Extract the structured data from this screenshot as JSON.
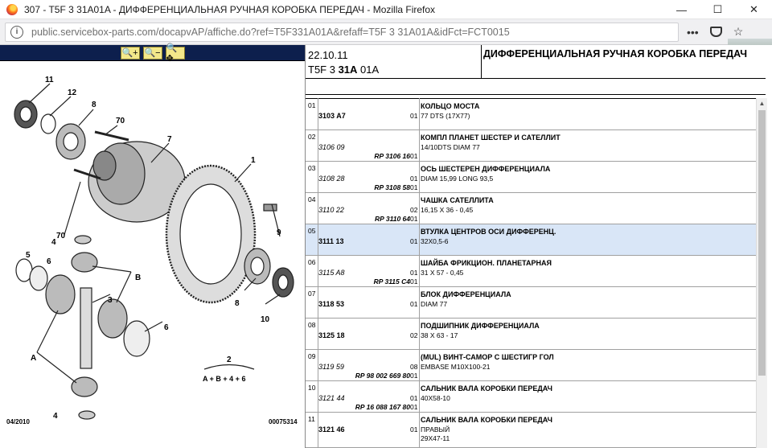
{
  "window": {
    "title": "307 - T5F 3 31A01A - ДИФФЕРЕНЦИАЛЬНАЯ РУЧНАЯ КОРОБКА ПЕРЕДАЧ - Mozilla Firefox",
    "minimize": "—",
    "restore": "☐",
    "close": "✕"
  },
  "urlbar": {
    "url": "public.servicebox-parts.com/docapvAP/affiche.do?ref=T5F331A01A&refaff=T5F 3 31A01A&idFct=FCT0015",
    "more": "•••",
    "star": "☆"
  },
  "zoom": {
    "in": "🔍+",
    "out": "🔍−",
    "fit": "🔍✥"
  },
  "diagram": {
    "date": "04/2010",
    "number": "00075314",
    "callouts": [
      "11",
      "12",
      "8",
      "70",
      "7",
      "1",
      "70",
      "9",
      "4",
      "5",
      "6",
      "B",
      "3",
      "6",
      "8",
      "10",
      "A",
      "4",
      "2"
    ],
    "formula": "A + B + 4 + 6"
  },
  "header": {
    "date": "22.10.11",
    "ref_prefix": "T5F 3 ",
    "ref_bold": "31A",
    "ref_suffix": " 01A",
    "title": "ДИФФЕРЕНЦИАЛЬНАЯ РУЧНАЯ КОРОБКА ПЕРЕДАЧ"
  },
  "rows": [
    {
      "idx": "01",
      "code": "3103 A7",
      "italic": false,
      "rp": "",
      "qty": "01",
      "qty2": "",
      "name": "КОЛЬЦО МОСТА",
      "desc": "77 DTS (17X77)",
      "desc2": "",
      "selected": false
    },
    {
      "idx": "02",
      "code": "3106 09",
      "italic": true,
      "rp": "RP 3106 16",
      "qty": "",
      "qty2": "01",
      "name": "КОМПЛ ПЛАНЕТ ШЕСТЕР И САТЕЛЛИТ",
      "desc": "14/10DTS DIAM 77",
      "desc2": "",
      "selected": false
    },
    {
      "idx": "03",
      "code": "3108 28",
      "italic": true,
      "rp": "RP 3108 58",
      "qty": "01",
      "qty2": "01",
      "name": "ОСЬ ШЕСТЕРЕН ДИФФЕРЕНЦИАЛА",
      "desc": "DIAM 15,99 LONG 93,5",
      "desc2": "",
      "selected": false
    },
    {
      "idx": "04",
      "code": "3110 22",
      "italic": true,
      "rp": "RP 3110 64",
      "qty": "02",
      "qty2": "01",
      "name": "ЧАШКА САТЕЛЛИТА",
      "desc": "16,15 X 36 - 0,45",
      "desc2": "",
      "selected": false
    },
    {
      "idx": "05",
      "code": "3111 13",
      "italic": false,
      "rp": "",
      "qty": "01",
      "qty2": "",
      "name": "ВТУЛКА ЦЕНТРОВ ОСИ ДИФФЕРЕНЦ.",
      "desc": "32X0,5-6",
      "desc2": "",
      "selected": true
    },
    {
      "idx": "06",
      "code": "3115 A8",
      "italic": true,
      "rp": "RP 3115 C4",
      "qty": "01",
      "qty2": "01",
      "name": "ШАЙБА ФРИКЦИОН. ПЛАНЕТАРНАЯ",
      "desc": "31 X 57 - 0,45",
      "desc2": "",
      "selected": false
    },
    {
      "idx": "07",
      "code": "3118 53",
      "italic": false,
      "rp": "",
      "qty": "01",
      "qty2": "",
      "name": "БЛОК ДИФФЕРЕНЦИАЛА",
      "desc": "DIAM 77",
      "desc2": "",
      "selected": false
    },
    {
      "idx": "08",
      "code": "3125 18",
      "italic": false,
      "rp": "",
      "qty": "02",
      "qty2": "",
      "name": "ПОДШИПНИК ДИФФЕРЕНЦИАЛА",
      "desc": "38 X 63 - 17",
      "desc2": "",
      "selected": false
    },
    {
      "idx": "09",
      "code": "3119 59",
      "italic": true,
      "rp": "RP 98 002 669 80",
      "qty": "08",
      "qty2": "01",
      "name": "(MUL) ВИНТ-САМОР С ШЕСТИГР ГОЛ",
      "desc": "EMBASE M10X100-21",
      "desc2": "",
      "selected": false
    },
    {
      "idx": "10",
      "code": "3121 44",
      "italic": true,
      "rp": "RP 16 088 167 80",
      "qty": "01",
      "qty2": "01",
      "name": "САЛЬНИК ВАЛА КОРОБКИ ПЕРЕДАЧ",
      "desc": "40X58-10",
      "desc2": "",
      "selected": false
    },
    {
      "idx": "11",
      "code": "3121 46",
      "italic": false,
      "rp": "",
      "qty": "01",
      "qty2": "",
      "name": "САЛЬНИК ВАЛА КОРОБКИ ПЕРЕДАЧ",
      "desc": "ПРАВЫЙ",
      "desc2": "29X47-11",
      "selected": false
    }
  ]
}
